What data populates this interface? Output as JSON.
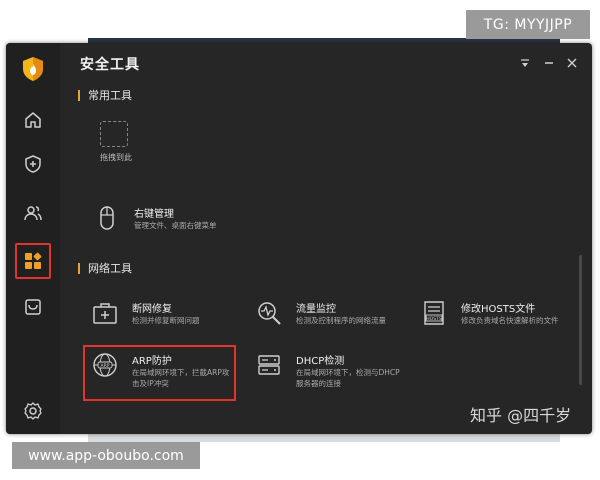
{
  "window": {
    "title": "安全工具"
  },
  "sidebar": {
    "items": [
      {
        "name": "home-icon"
      },
      {
        "name": "shield-plus-icon"
      },
      {
        "name": "users-icon"
      },
      {
        "name": "toolbox-icon",
        "active": true
      },
      {
        "name": "store-icon"
      },
      {
        "name": "gear-icon"
      }
    ]
  },
  "sections": {
    "common": {
      "label": "常用工具"
    },
    "network": {
      "label": "网络工具"
    }
  },
  "common_tools": {
    "drag_label": "拖拽到此",
    "right_click": {
      "name": "右键管理",
      "desc": "管理文件、桌面右键菜单",
      "icon": "mouse-icon"
    }
  },
  "network_tools": [
    {
      "name": "断网修复",
      "desc": "检测并修复断网问题",
      "icon": "toolbox-plus-icon"
    },
    {
      "name": "流量监控",
      "desc": "检测及控制程序的网络流量",
      "icon": "magnifier-pulse-icon"
    },
    {
      "name": "修改HOSTS文件",
      "desc": "修改负责域名快速解析的文件",
      "icon": "hosts-file-icon"
    },
    {
      "name": "ARP防护",
      "desc1": "在局域网环境下，拦截ARP攻",
      "desc2": "击及IP冲突",
      "icon": "arp-globe-icon"
    },
    {
      "name": "DHCP检测",
      "desc1": "在局域网环境下，检测与DHCP",
      "desc2": "服务器的连接",
      "icon": "server-icon"
    }
  ],
  "watermarks": {
    "top": "TG: MYYJJPP",
    "bottom": "www.app-oboubo.com",
    "zhihu": "知乎 @四千岁"
  },
  "colors": {
    "accent": "#e0342c",
    "section_bar": "#e8a33a",
    "background": "#262626",
    "sidebar": "#202020"
  }
}
